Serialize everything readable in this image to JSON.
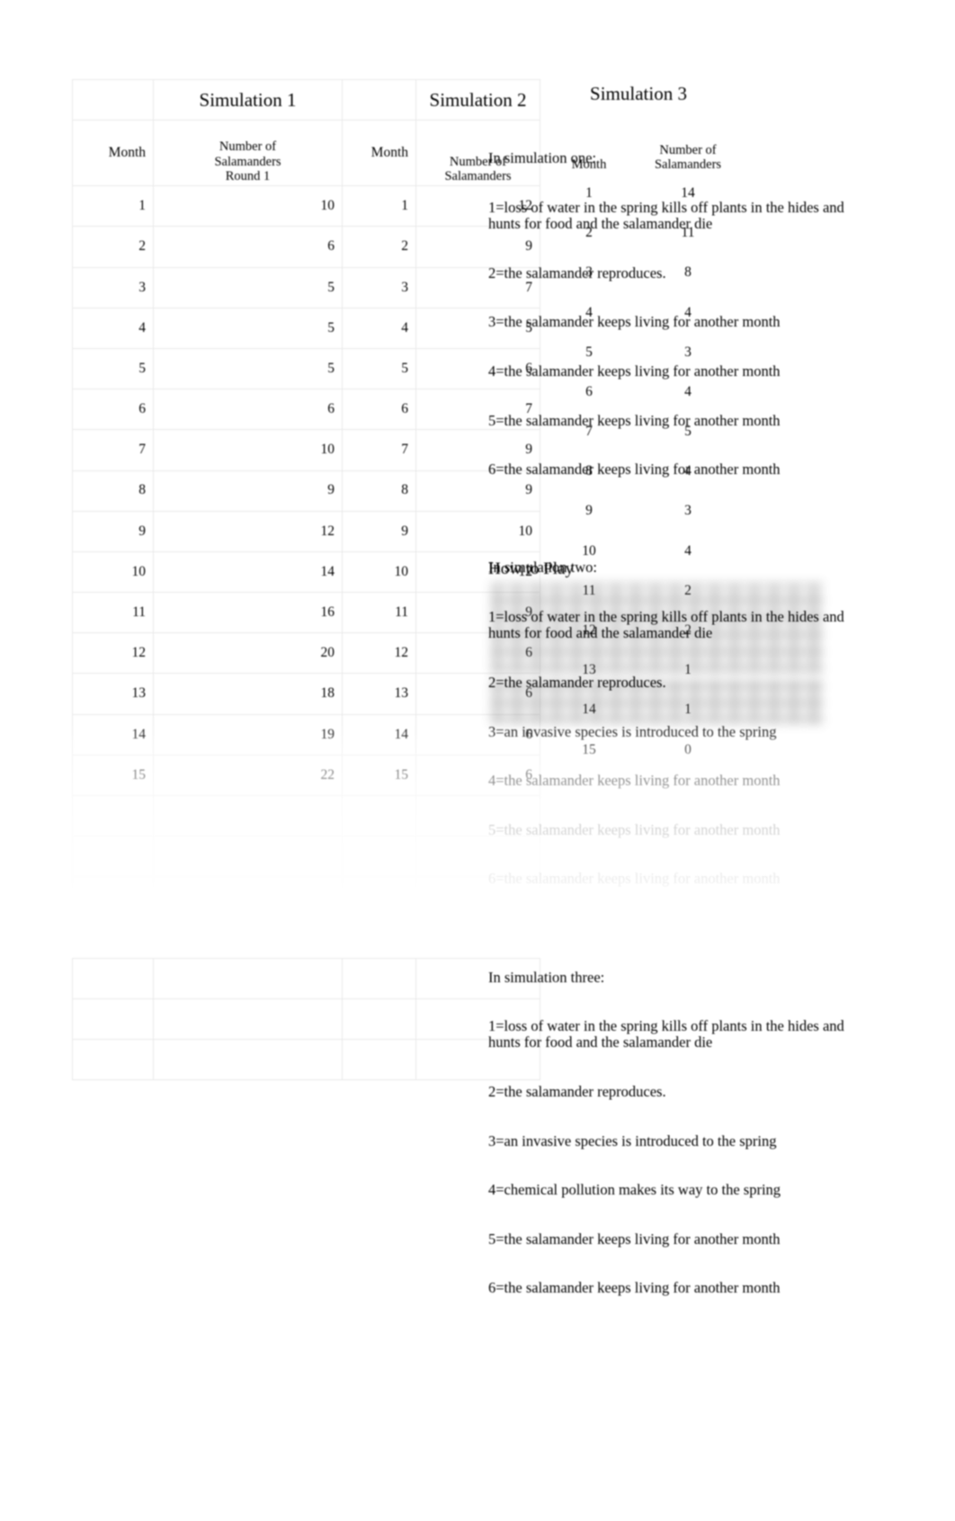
{
  "document": {
    "kind": "spreadsheet-page",
    "background_color": "#ffffff",
    "text_color": "#000000",
    "grid_line_color": "#e9e9e9"
  },
  "tables": [
    {
      "id": "simulation-1",
      "title": "Simulation 1",
      "columns": [
        "Month",
        "Number of Salamanders Round 1"
      ],
      "column_headers": {
        "month": "Month",
        "value_line1": "Number of",
        "value_line2": "Salamanders",
        "value_line3": "Round 1"
      },
      "rows": [
        {
          "month": "1",
          "value": "10"
        },
        {
          "month": "2",
          "value": "6"
        },
        {
          "month": "3",
          "value": "5"
        },
        {
          "month": "4",
          "value": "5"
        },
        {
          "month": "5",
          "value": "5"
        },
        {
          "month": "6",
          "value": "6"
        },
        {
          "month": "7",
          "value": "10"
        },
        {
          "month": "8",
          "value": "9"
        },
        {
          "month": "9",
          "value": "12"
        },
        {
          "month": "10",
          "value": "14"
        },
        {
          "month": "11",
          "value": "16"
        },
        {
          "month": "12",
          "value": "20"
        },
        {
          "month": "13",
          "value": "18"
        },
        {
          "month": "14",
          "value": "19"
        },
        {
          "month": "15",
          "value": "22"
        }
      ],
      "empty_rows": 7
    },
    {
      "id": "simulation-2",
      "title": "Simulation 2",
      "columns": [
        "Month",
        "Number of Salamanders"
      ],
      "column_headers": {
        "month": "Month",
        "value_line1": "Number of",
        "value_line2": "Salamanders",
        "value_line3": ""
      },
      "rows": [
        {
          "month": "1",
          "value": "12"
        },
        {
          "month": "2",
          "value": "9"
        },
        {
          "month": "3",
          "value": "7"
        },
        {
          "month": "4",
          "value": "5"
        },
        {
          "month": "5",
          "value": "6"
        },
        {
          "month": "6",
          "value": "7"
        },
        {
          "month": "7",
          "value": "9"
        },
        {
          "month": "8",
          "value": "9"
        },
        {
          "month": "9",
          "value": "10"
        },
        {
          "month": "10",
          "value": "12"
        },
        {
          "month": "11",
          "value": "9"
        },
        {
          "month": "12",
          "value": "6"
        },
        {
          "month": "13",
          "value": "6"
        },
        {
          "month": "14",
          "value": "6"
        },
        {
          "month": "15",
          "value": "6"
        }
      ],
      "empty_rows": 7
    },
    {
      "id": "simulation-3",
      "title": "Simulation 3",
      "columns": [
        "Month",
        "Number of Salamanders"
      ],
      "column_headers": {
        "month": "Month",
        "value_line1": "Number of",
        "value_line2": "Salamanders",
        "value_line3": ""
      },
      "rows": [
        {
          "month": "1",
          "value": "14"
        },
        {
          "month": "2",
          "value": "11"
        },
        {
          "month": "3",
          "value": "8"
        },
        {
          "month": "4",
          "value": "4"
        },
        {
          "month": "5",
          "value": "3"
        },
        {
          "month": "6",
          "value": "4"
        },
        {
          "month": "7",
          "value": "5"
        },
        {
          "month": "8",
          "value": "4"
        },
        {
          "month": "9",
          "value": "3"
        },
        {
          "month": "10",
          "value": "4"
        },
        {
          "month": "11",
          "value": "2"
        },
        {
          "month": "12",
          "value": "2"
        },
        {
          "month": "13",
          "value": "1"
        },
        {
          "month": "14",
          "value": "1"
        },
        {
          "month": "15",
          "value": "0"
        }
      ],
      "empty_rows": 0
    }
  ],
  "rules_text": {
    "sim_one": {
      "heading": "In simulation one:",
      "lines": [
        "1=loss of water in the spring kills off plants in the hides and hunts for food and the salamander die",
        "2=the salamander reproduces.",
        "3=the salamander keeps living for another month",
        "4=the salamander keeps living for another month",
        "5=the salamander keeps living for another month",
        "6=the salamander keeps living for another month"
      ]
    },
    "sim_two": {
      "heading": "In simulation two:",
      "lines": [
        "1=loss of water in the spring kills off plants in the hides and hunts for food and the salamander die",
        "2=the salamander reproduces.",
        "3=an invasive species is introduced to the spring",
        "4=the salamander keeps living for another month",
        "5=the salamander keeps living for another month",
        "6=the salamander keeps living for another month"
      ]
    },
    "sim_three": {
      "heading": "In simulation three:",
      "lines": [
        "1=loss of water in the spring kills off plants in the hides and hunts for food and the salamander die",
        "2=the salamander reproduces.",
        "3=an invasive species is introduced to the spring",
        "4=chemical pollution makes its way to the spring",
        "5=the salamander keeps living for another month",
        "6=the salamander keeps living for another month"
      ]
    },
    "how_to_play_heading": "How to Play"
  },
  "redacted_regions": [
    {
      "name": "blurred-paragraph-1",
      "note": "blurred text block below How to Play"
    },
    {
      "name": "blurred-paragraph-2",
      "note": "blurred text block, second band"
    }
  ]
}
